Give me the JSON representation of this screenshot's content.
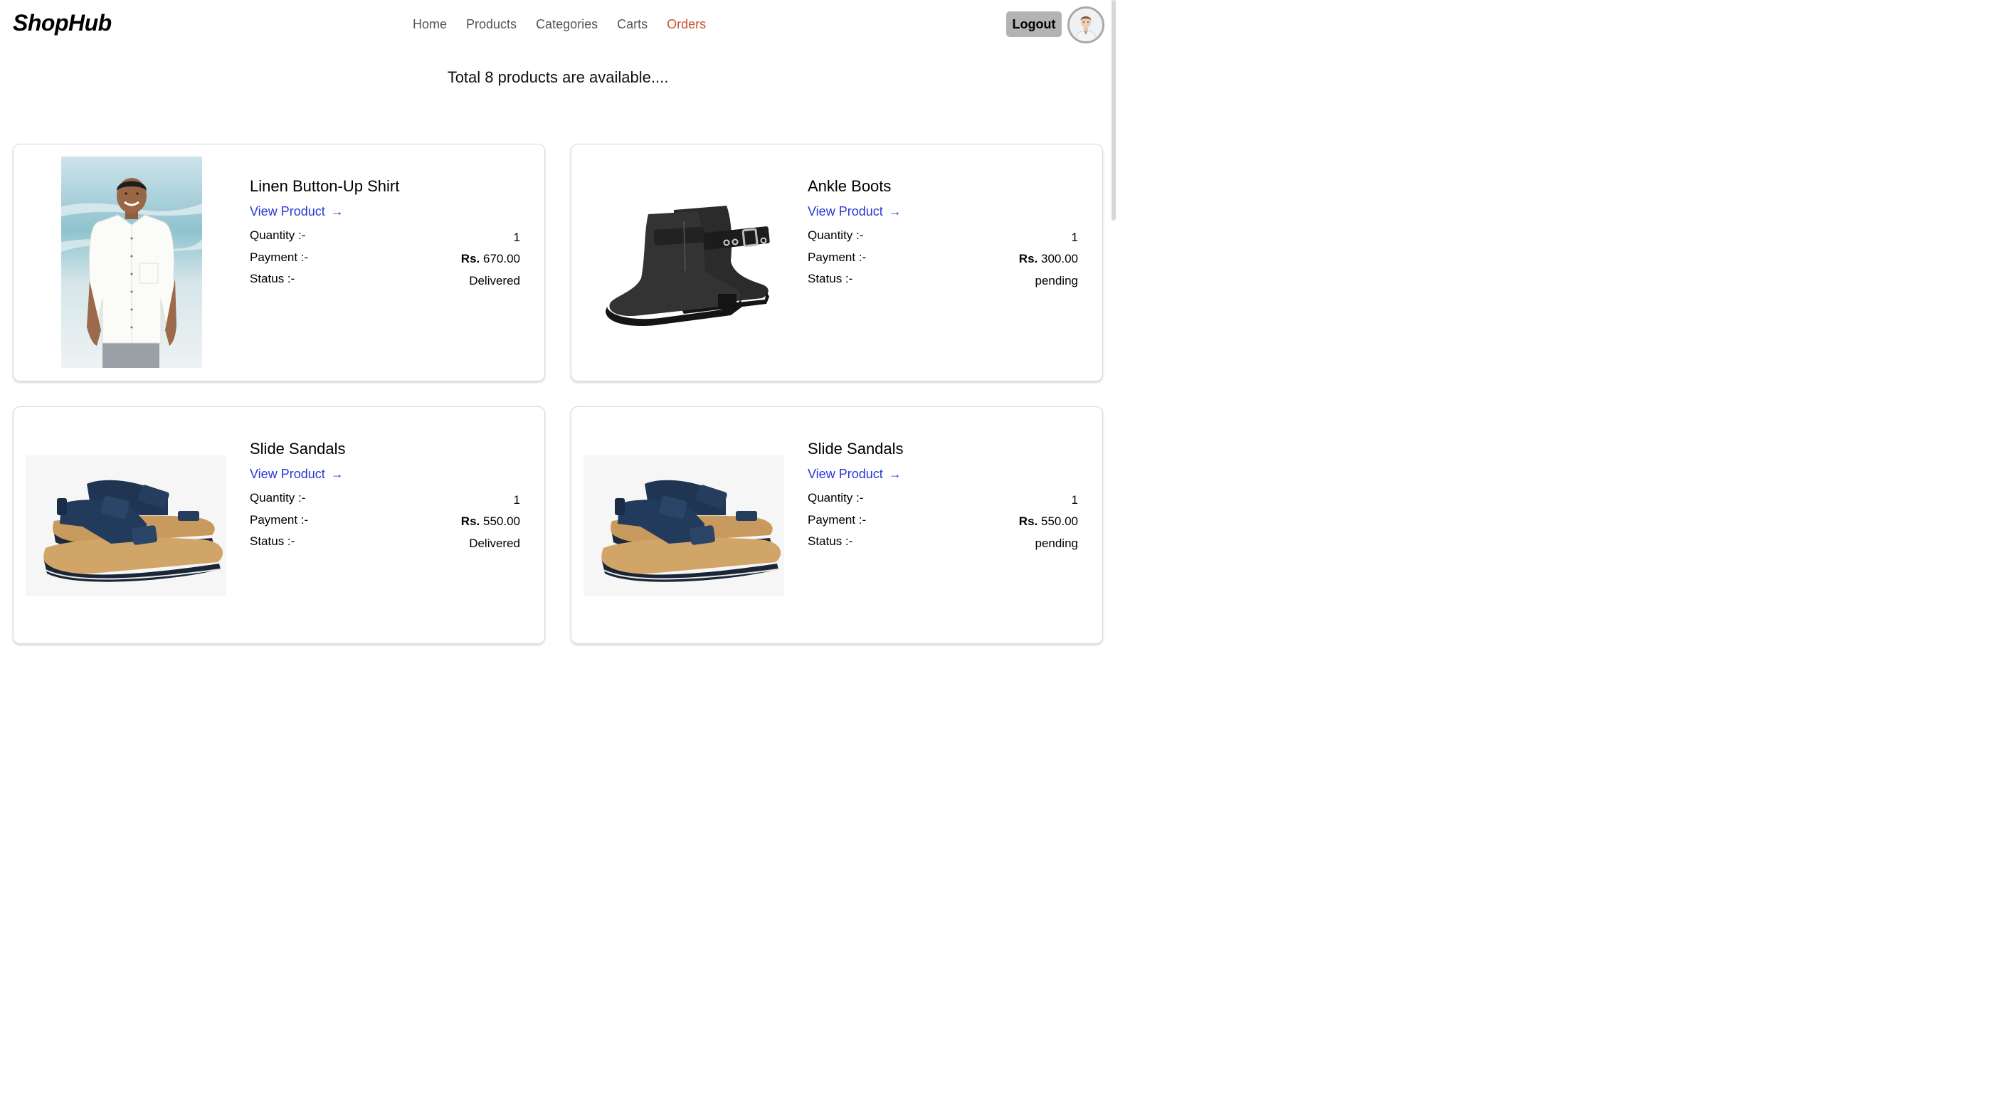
{
  "brand": "ShopHub",
  "nav": {
    "items": [
      {
        "label": "Home"
      },
      {
        "label": "Products"
      },
      {
        "label": "Categories"
      },
      {
        "label": "Carts"
      },
      {
        "label": "Orders"
      }
    ],
    "active": "Orders"
  },
  "header": {
    "logout_label": "Logout"
  },
  "page": {
    "heading": "Total 8 products are available...."
  },
  "labels": {
    "view_product": "View Product",
    "arrow": "→",
    "quantity": "Quantity :-",
    "payment": "Payment :-",
    "status": "Status :-",
    "currency": "Rs."
  },
  "orders": [
    {
      "title": "Linen Button-Up Shirt",
      "quantity": "1",
      "payment": "670.00",
      "status": "Delivered",
      "image": "shirt-photo"
    },
    {
      "title": "Ankle Boots",
      "quantity": "1",
      "payment": "300.00",
      "status": "pending",
      "image": "boots-photo"
    },
    {
      "title": "Slide Sandals",
      "quantity": "1",
      "payment": "550.00",
      "status": "Delivered",
      "image": "sandals-photo"
    },
    {
      "title": "Slide Sandals",
      "quantity": "1",
      "payment": "550.00",
      "status": "pending",
      "image": "sandals-photo"
    }
  ],
  "colors": {
    "active_nav": "#c9512e",
    "link": "#2a37d9",
    "logout_bg": "#b3b3b3"
  }
}
